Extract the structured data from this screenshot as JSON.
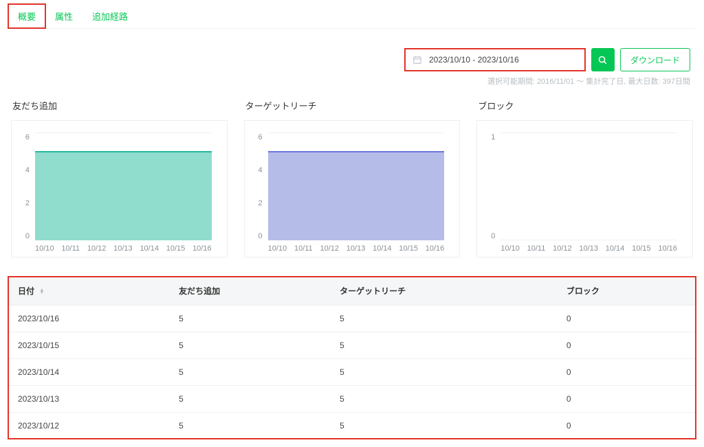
{
  "tabs": [
    "概要",
    "属性",
    "追加経路"
  ],
  "active_tab_index": 0,
  "toolbar": {
    "date_range": "2023/10/10 - 2023/10/16",
    "download_label": "ダウンロード",
    "hint": "選択可能期間: 2016/11/01 ～ 集計完了日, 最大日数: 397日間"
  },
  "chart_data": [
    {
      "type": "area",
      "title": "友だち追加",
      "categories": [
        "10/10",
        "10/11",
        "10/12",
        "10/13",
        "10/14",
        "10/15",
        "10/16"
      ],
      "values": [
        5,
        5,
        5,
        5,
        5,
        5,
        5
      ],
      "ylim": [
        0,
        6
      ],
      "yticks": [
        6,
        4,
        2,
        0
      ],
      "color_fill": "#90dccd",
      "color_line": "#22b9a0"
    },
    {
      "type": "area",
      "title": "ターゲットリーチ",
      "categories": [
        "10/10",
        "10/11",
        "10/12",
        "10/13",
        "10/14",
        "10/15",
        "10/16"
      ],
      "values": [
        5,
        5,
        5,
        5,
        5,
        5,
        5
      ],
      "ylim": [
        0,
        6
      ],
      "yticks": [
        6,
        4,
        2,
        0
      ],
      "color_fill": "#b6bce8",
      "color_line": "#6a77d8"
    },
    {
      "type": "area",
      "title": "ブロック",
      "categories": [
        "10/10",
        "10/11",
        "10/12",
        "10/13",
        "10/14",
        "10/15",
        "10/16"
      ],
      "values": [
        0,
        0,
        0,
        0,
        0,
        0,
        0
      ],
      "ylim": [
        0,
        1
      ],
      "yticks": [
        1,
        0
      ],
      "color_fill": "#ffffff",
      "color_line": "#ffffff"
    }
  ],
  "table": {
    "headers": [
      "日付",
      "友だち追加",
      "ターゲットリーチ",
      "ブロック"
    ],
    "sortable_col": 0,
    "rows": [
      {
        "date": "2023/10/16",
        "addfriends": "5",
        "reach": "5",
        "block": "0"
      },
      {
        "date": "2023/10/15",
        "addfriends": "5",
        "reach": "5",
        "block": "0"
      },
      {
        "date": "2023/10/14",
        "addfriends": "5",
        "reach": "5",
        "block": "0"
      },
      {
        "date": "2023/10/13",
        "addfriends": "5",
        "reach": "5",
        "block": "0"
      },
      {
        "date": "2023/10/12",
        "addfriends": "5",
        "reach": "5",
        "block": "0"
      }
    ]
  }
}
